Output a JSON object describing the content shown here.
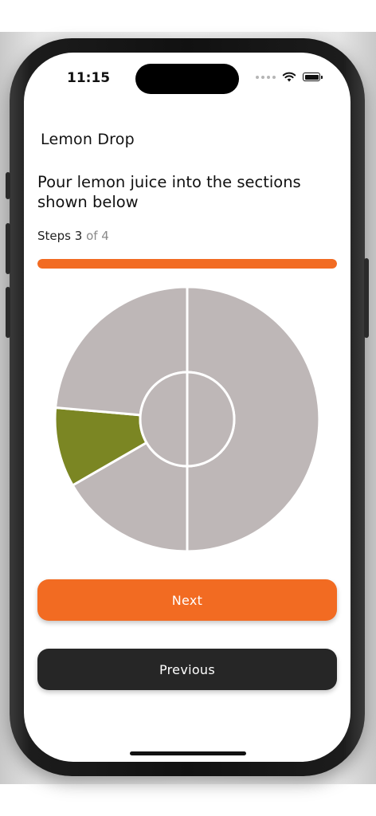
{
  "status_bar": {
    "time": "11:15",
    "signal_icon": "signal-dots-icon",
    "wifi_icon": "wifi-icon",
    "battery_icon": "battery-icon"
  },
  "header": {
    "title": "Lemon Drop"
  },
  "instruction": "Pour lemon juice into the sections shown below",
  "progress": {
    "label": "Steps",
    "current": "3",
    "of_text": "of 4",
    "fraction": 1.0,
    "color": "#f26b22"
  },
  "section_chart": {
    "colors": {
      "empty": "#beb7b7",
      "highlighted": "#7b8623",
      "divider": "#ffffff"
    },
    "outer_sections": [
      {
        "label": "right half",
        "highlighted": false
      },
      {
        "label": "bottom-left",
        "highlighted": false
      },
      {
        "label": "left",
        "highlighted": true
      },
      {
        "label": "top-left",
        "highlighted": false
      }
    ],
    "center_section": {
      "highlighted": false
    }
  },
  "buttons": {
    "next": "Next",
    "previous": "Previous"
  }
}
